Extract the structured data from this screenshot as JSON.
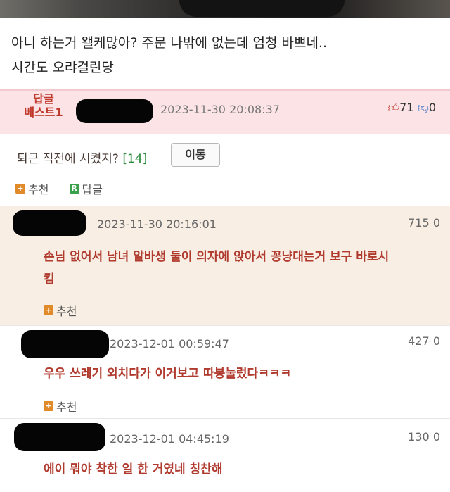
{
  "post": {
    "line1": "아니 하는거 왤케많아? 주문 나밖에 없는데 엄청 바쁘네..",
    "line2": "시간도 오랴걸린당"
  },
  "best_reply": {
    "label_line1": "답글",
    "label_line2": "베스트1",
    "date": "2023-11-30 20:08:37",
    "up_count": "71",
    "down_count": "0",
    "text": "퇴근 직전에 시켰지?",
    "reply_count": "[14]",
    "move_label": "이동",
    "recommend_label": "추천",
    "reply_label": "답글"
  },
  "comments": [
    {
      "date": "2023-11-30 20:16:01",
      "up": "715",
      "down": "0",
      "text_line1": "손님 없어서 남녀 알바생 둘이 의자에 앉아서 꽁냥대는거 보구 바로시",
      "text_line2": "킴",
      "recommend_label": "추천"
    },
    {
      "date": "2023-12-01 00:59:47",
      "up": "427",
      "down": "0",
      "text_line1": "우우 쓰레기 외치다가 이거보고 따봉눌렀다ㅋㅋㅋ",
      "text_line2": "",
      "recommend_label": "추천"
    },
    {
      "date": "2023-12-01 04:45:19",
      "up": "130",
      "down": "0",
      "text_line1": "에이 뭐야 착한 일 한 거였네 칭찬해",
      "text_line2": "",
      "recommend_label": ""
    }
  ],
  "icons": {
    "thumb_up": "thumbs-up-icon",
    "thumb_down": "thumbs-down-icon",
    "recommend": "plus-square-icon",
    "reply": "reply-square-icon"
  },
  "colors": {
    "best_bg": "#fbe3e6",
    "comment_highlight_bg": "#f8eee4",
    "comment_text": "#b03a2e",
    "best_label": "#c0392b"
  }
}
